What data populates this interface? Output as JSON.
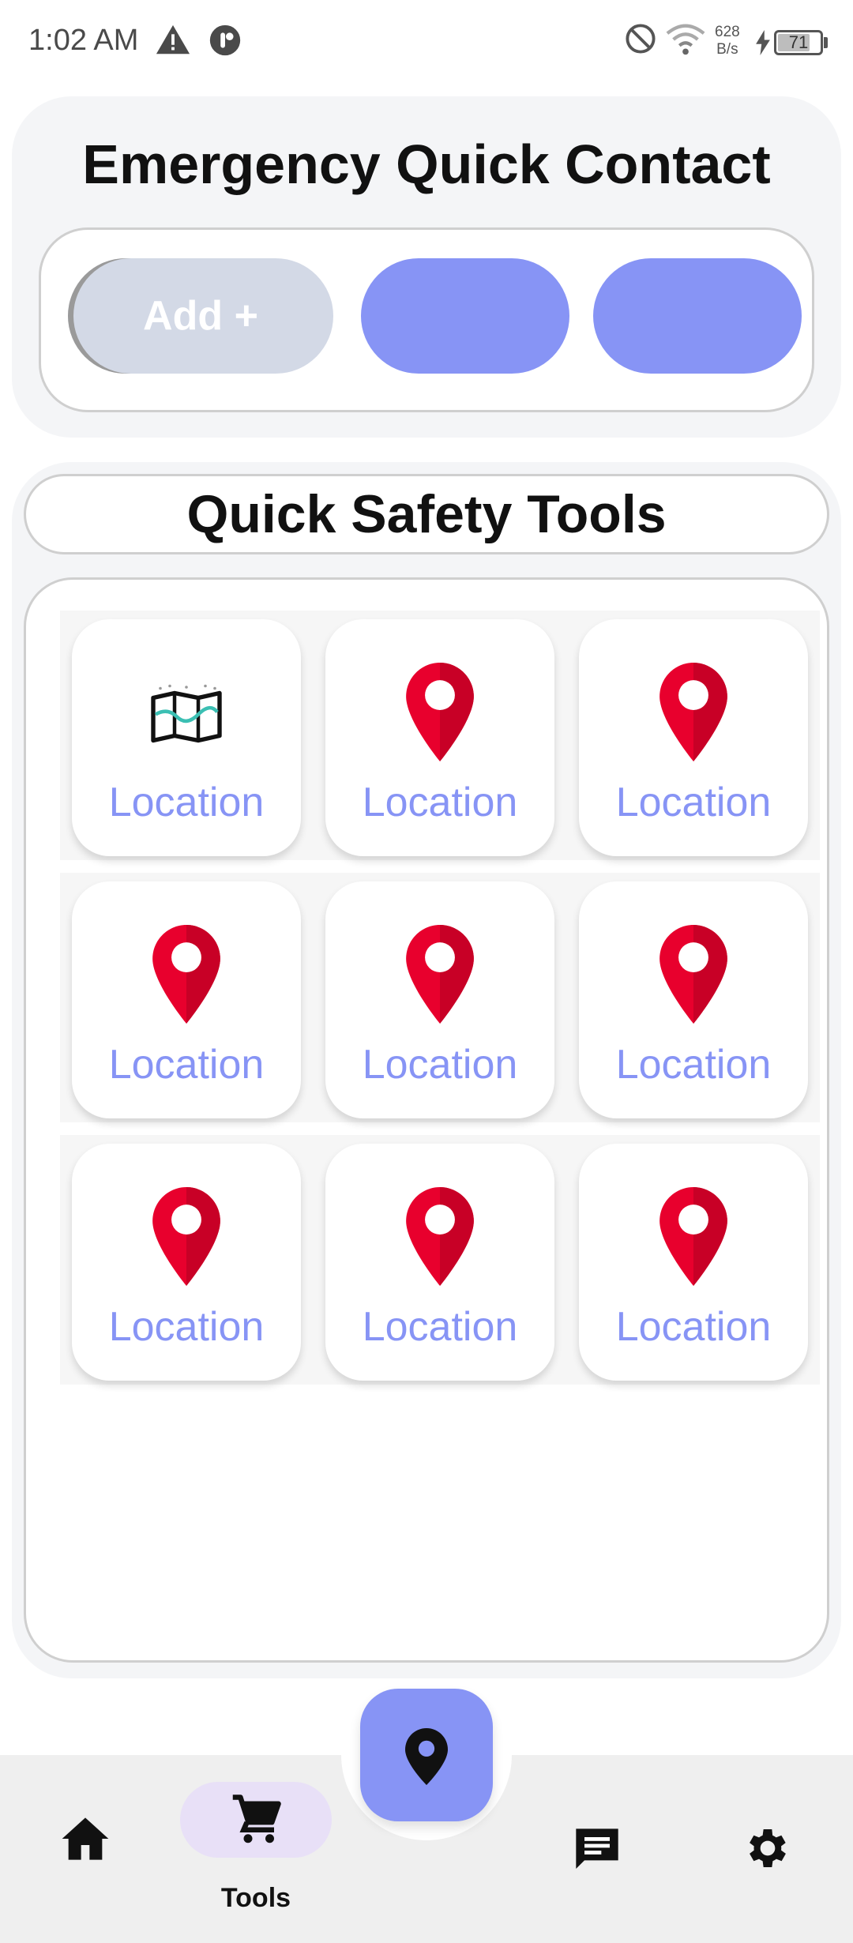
{
  "status_bar": {
    "time": "1:02 AM",
    "net_speed_value": "628",
    "net_speed_unit": "B/s",
    "battery_level": "71"
  },
  "emergency": {
    "title": "Emergency Quick Contact",
    "add_label": "Add +"
  },
  "tools": {
    "title": "Quick Safety Tools",
    "tiles": [
      {
        "label": "Location",
        "icon": "map-icon"
      },
      {
        "label": "Location",
        "icon": "location-pin-icon"
      },
      {
        "label": "Location",
        "icon": "location-pin-icon"
      },
      {
        "label": "Location",
        "icon": "location-pin-icon"
      },
      {
        "label": "Location",
        "icon": "location-pin-icon"
      },
      {
        "label": "Location",
        "icon": "location-pin-icon"
      },
      {
        "label": "Location",
        "icon": "location-pin-icon"
      },
      {
        "label": "Location",
        "icon": "location-pin-icon"
      },
      {
        "label": "Location",
        "icon": "location-pin-icon"
      }
    ]
  },
  "nav": {
    "tools_label": "Tools"
  },
  "colors": {
    "accent": "#8794f5",
    "pin": "#e8002d",
    "card_bg": "#f4f5f7"
  }
}
